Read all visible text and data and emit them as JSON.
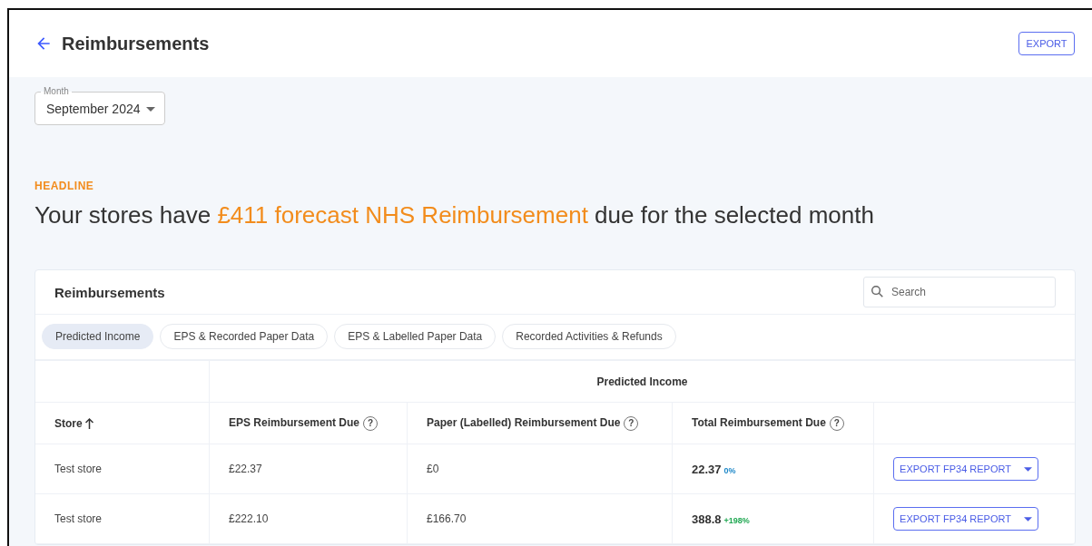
{
  "header": {
    "title": "Reimbursements",
    "export_button": "EXPORT"
  },
  "month_select": {
    "label": "Month",
    "value": "September 2024"
  },
  "headline": {
    "eyebrow": "HEADLINE",
    "prefix": "Your stores have ",
    "highlight": "£411 forecast NHS Reimbursement",
    "suffix": " due for the selected month"
  },
  "card": {
    "title": "Reimbursements",
    "search": {
      "placeholder": "Search"
    },
    "tabs": [
      {
        "label": "Predicted Income",
        "selected": true
      },
      {
        "label": "EPS & Recorded Paper Data",
        "selected": false
      },
      {
        "label": "EPS & Labelled Paper Data",
        "selected": false
      },
      {
        "label": "Recorded Activities & Refunds",
        "selected": false
      }
    ],
    "table": {
      "group_header": "Predicted Income",
      "columns": [
        {
          "label": "Store",
          "sorted": true
        },
        {
          "label": "EPS Reimbursement Due",
          "sorted": false,
          "help": "?"
        },
        {
          "label": "Paper (Labelled) Reimbursement Due",
          "sorted": false,
          "help": "?"
        },
        {
          "label": "Total Reimbursement Due",
          "sorted": false,
          "help": "?"
        }
      ],
      "rows": [
        {
          "store": "Test store",
          "eps": "£22.37",
          "paper": "£0",
          "total": "22.37",
          "change": "0%",
          "color": "#1e88c8",
          "action": "EXPORT FP34 REPORT"
        },
        {
          "store": "Test store",
          "eps": "£222.10",
          "paper": "£166.70",
          "total": "388.8",
          "change": "+198%",
          "color": "#21a853",
          "action": "EXPORT FP34 REPORT"
        }
      ]
    }
  }
}
